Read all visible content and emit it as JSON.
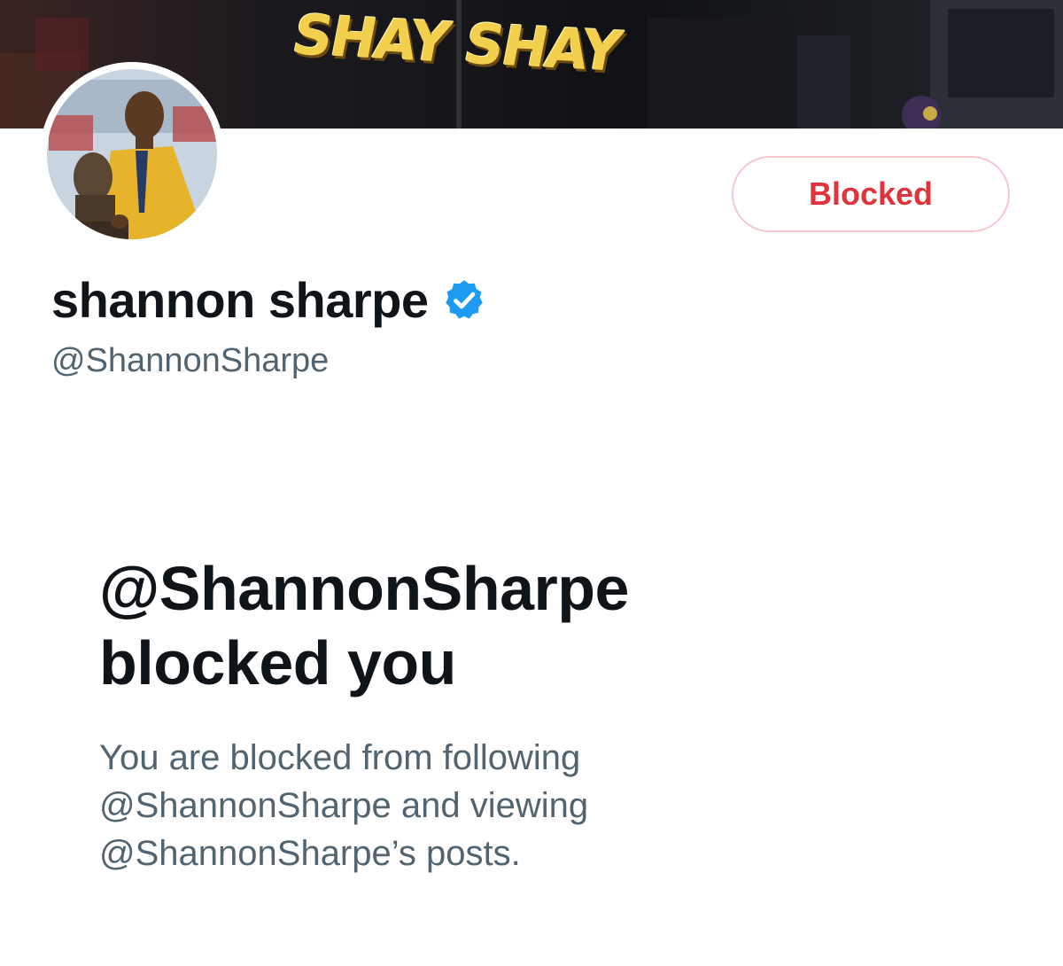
{
  "banner": {
    "text": "SHAY SHAY"
  },
  "profile": {
    "display_name": "shannon sharpe",
    "handle": "@ShannonSharpe",
    "verified_icon": "verified-badge-icon"
  },
  "actions": {
    "block_button_label": "Blocked"
  },
  "block_notice": {
    "title_line1": "@ShannonSharpe",
    "title_line2": "blocked you",
    "description_line1": "You are blocked from following",
    "description_line2": "@ShannonSharpe and viewing",
    "description_line3": "@ShannonSharpe’s posts."
  },
  "colors": {
    "blocked_red": "#e0333c",
    "blocked_border": "#f6c8cc",
    "verified_blue": "#1d9bf0",
    "secondary_text": "#536471",
    "primary_text": "#0f1419"
  }
}
